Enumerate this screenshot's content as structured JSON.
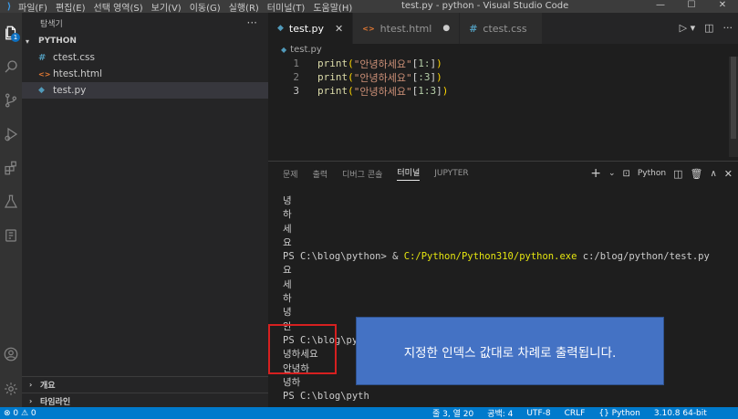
{
  "titlebar": {
    "menu": [
      "파일(F)",
      "편집(E)",
      "선택 영역(S)",
      "보기(V)",
      "이동(G)",
      "실행(R)",
      "터미널(T)",
      "도움말(H)"
    ],
    "window_title": "test.py - python - Visual Studio Code",
    "minimize": "—",
    "maximize": "☐",
    "close": "✕"
  },
  "activity": {
    "badge": "1"
  },
  "sidebar": {
    "title": "탐색기",
    "more": "···",
    "section": "PYTHON",
    "files": [
      {
        "icon": "#",
        "name": "ctest.css",
        "color": "#519aba"
      },
      {
        "icon": "<>",
        "name": "htest.html",
        "color": "#e37933"
      },
      {
        "icon": "◆",
        "name": "test.py",
        "color": "#519aba"
      }
    ],
    "outline": "개요",
    "timeline": "타임라인"
  },
  "tabs": [
    {
      "icon": "◆",
      "label": "test.py",
      "mark": "✕"
    },
    {
      "icon": "<>",
      "label": "htest.html",
      "mark": "●"
    },
    {
      "icon": "#",
      "label": "ctest.css",
      "mark": ""
    }
  ],
  "editor": {
    "breadcrumb": "test.py",
    "lines": [
      {
        "n": "1",
        "fn": "print",
        "open": "(",
        "str": "\"안녕하세요\"",
        "br1": "[",
        "idx": "1:",
        "br2": "]",
        "close": ")"
      },
      {
        "n": "2",
        "fn": "print",
        "open": "(",
        "str": "\"안녕하세요\"",
        "br1": "[",
        "idx": ":3",
        "br2": "]",
        "close": ")"
      },
      {
        "n": "3",
        "fn": "print",
        "open": "(",
        "str": "\"안녕하세요\"",
        "br1": "[",
        "idx": "1:3",
        "br2": "]",
        "close": ")"
      }
    ]
  },
  "panel": {
    "tabs": [
      "문제",
      "출력",
      "디버그 콘솔",
      "터미널",
      "JUPYTER"
    ],
    "shell": "Python",
    "terminal": {
      "pre": [
        "녕",
        "하",
        "세",
        "요"
      ],
      "prompt": "PS C:\\blog\\python> & ",
      "exe": "C:/Python/Python310/python.exe",
      "arg": " c:/blog/python/test.py",
      "post": [
        "요",
        "세",
        "하",
        "녕",
        "안",
        "PS C:\\blog\\pyth",
        "녕하세요",
        "안녕하",
        "녕하",
        "PS C:\\blog\\pyth"
      ]
    }
  },
  "callout": "지정한 인덱스 값대로 차례로 출력됩니다.",
  "statusbar": {
    "errors": "⊗ 0 ⚠ 0",
    "position": "줄 3, 열 20",
    "spaces": "공백: 4",
    "encoding": "UTF-8",
    "eol": "CRLF",
    "language": "{} Python",
    "interpreter": "3.10.8 64-bit"
  }
}
